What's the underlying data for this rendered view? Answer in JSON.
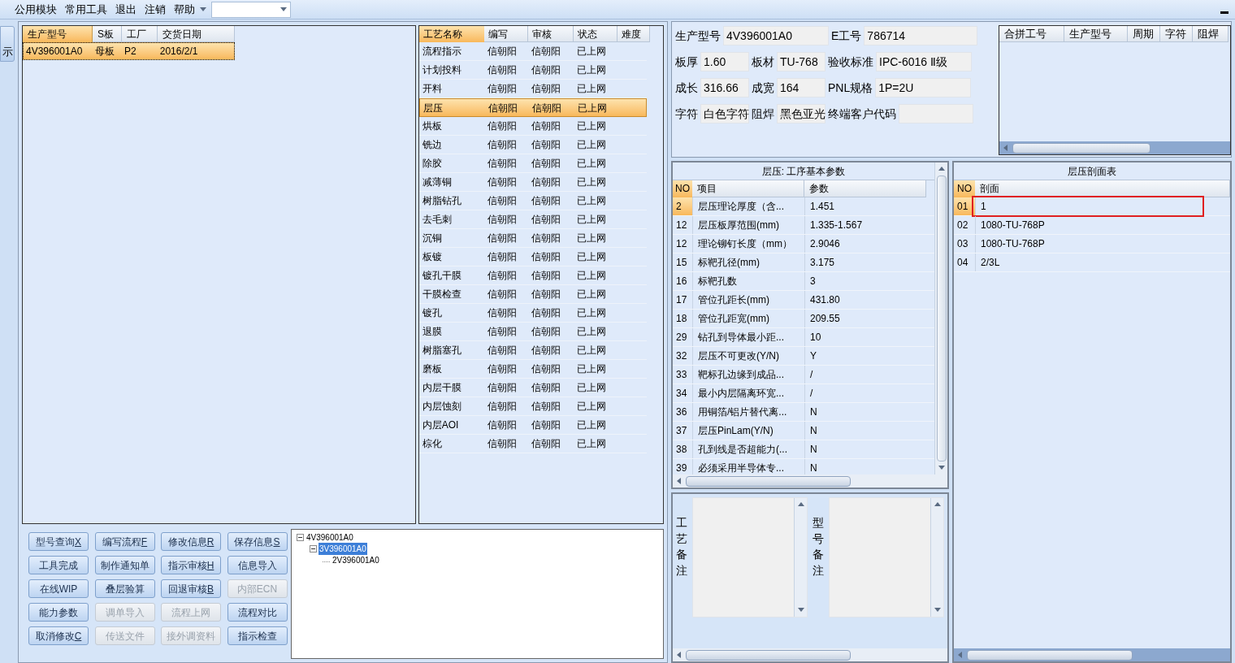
{
  "menu": {
    "items": [
      "公用模块",
      "常用工具",
      "退出",
      "注销",
      "帮助"
    ]
  },
  "side_button": "示",
  "order_table": {
    "columns": [
      "生产型号",
      "S板",
      "工厂",
      "交货日期"
    ],
    "rows": [
      {
        "cells": [
          "4V396001A0",
          "母板",
          "P2",
          "2016/2/1"
        ],
        "selected": true
      }
    ]
  },
  "process_table": {
    "columns": [
      "工艺名称",
      "编写",
      "审核",
      "状态",
      "难度"
    ],
    "rows": [
      {
        "cells": [
          "流程指示",
          "信朝阳",
          "信朝阳",
          "已上网"
        ],
        "selected": false
      },
      {
        "cells": [
          "计划投料",
          "信朝阳",
          "信朝阳",
          "已上网"
        ],
        "selected": false
      },
      {
        "cells": [
          "开料",
          "信朝阳",
          "信朝阳",
          "已上网"
        ],
        "selected": false
      },
      {
        "cells": [
          "层压",
          "信朝阳",
          "信朝阳",
          "已上网"
        ],
        "selected": true
      },
      {
        "cells": [
          "烘板",
          "信朝阳",
          "信朝阳",
          "已上网"
        ],
        "selected": false
      },
      {
        "cells": [
          "铣边",
          "信朝阳",
          "信朝阳",
          "已上网"
        ],
        "selected": false
      },
      {
        "cells": [
          "除胶",
          "信朝阳",
          "信朝阳",
          "已上网"
        ],
        "selected": false
      },
      {
        "cells": [
          "减薄铜",
          "信朝阳",
          "信朝阳",
          "已上网"
        ],
        "selected": false
      },
      {
        "cells": [
          "树脂钻孔",
          "信朝阳",
          "信朝阳",
          "已上网"
        ],
        "selected": false
      },
      {
        "cells": [
          "去毛刺",
          "信朝阳",
          "信朝阳",
          "已上网"
        ],
        "selected": false
      },
      {
        "cells": [
          "沉铜",
          "信朝阳",
          "信朝阳",
          "已上网"
        ],
        "selected": false
      },
      {
        "cells": [
          "板镀",
          "信朝阳",
          "信朝阳",
          "已上网"
        ],
        "selected": false
      },
      {
        "cells": [
          "镀孔干膜",
          "信朝阳",
          "信朝阳",
          "已上网"
        ],
        "selected": false
      },
      {
        "cells": [
          "干膜检查",
          "信朝阳",
          "信朝阳",
          "已上网"
        ],
        "selected": false
      },
      {
        "cells": [
          "镀孔",
          "信朝阳",
          "信朝阳",
          "已上网"
        ],
        "selected": false
      },
      {
        "cells": [
          "退膜",
          "信朝阳",
          "信朝阳",
          "已上网"
        ],
        "selected": false
      },
      {
        "cells": [
          "树脂塞孔",
          "信朝阳",
          "信朝阳",
          "已上网"
        ],
        "selected": false
      },
      {
        "cells": [
          "磨板",
          "信朝阳",
          "信朝阳",
          "已上网"
        ],
        "selected": false
      },
      {
        "cells": [
          "内层干膜",
          "信朝阳",
          "信朝阳",
          "已上网"
        ],
        "selected": false
      },
      {
        "cells": [
          "内层蚀刻",
          "信朝阳",
          "信朝阳",
          "已上网"
        ],
        "selected": false
      },
      {
        "cells": [
          "内层AOI",
          "信朝阳",
          "信朝阳",
          "已上网"
        ],
        "selected": false
      },
      {
        "cells": [
          "棕化",
          "信朝阳",
          "信朝阳",
          "已上网"
        ],
        "selected": false
      }
    ]
  },
  "buttons": [
    {
      "label": "型号查询",
      "key": "X",
      "disabled": false
    },
    {
      "label": "编写流程",
      "key": "F",
      "disabled": false
    },
    {
      "label": "修改信息",
      "key": "R",
      "disabled": false
    },
    {
      "label": "保存信息",
      "key": "S",
      "disabled": false
    },
    {
      "label": "工具完成",
      "disabled": false
    },
    {
      "label": "制作通知单",
      "disabled": false
    },
    {
      "label": "指示审核",
      "key": "H",
      "disabled": false
    },
    {
      "label": "信息导入",
      "disabled": false
    },
    {
      "label": "在线WIP",
      "disabled": false
    },
    {
      "label": "叠层验算",
      "disabled": false
    },
    {
      "label": "回退审核",
      "key": "B",
      "disabled": false
    },
    {
      "label": "内部ECN",
      "disabled": true
    },
    {
      "label": "能力参数",
      "disabled": false
    },
    {
      "label": "调单导入",
      "disabled": true
    },
    {
      "label": "流程上网",
      "disabled": true
    },
    {
      "label": "流程对比",
      "disabled": false
    },
    {
      "label": "取消修改",
      "key": "C",
      "disabled": false
    },
    {
      "label": "传送文件",
      "disabled": true
    },
    {
      "label": "接外调资料",
      "disabled": true
    },
    {
      "label": "指示检查",
      "disabled": false
    }
  ],
  "tree": {
    "items": [
      {
        "label": "4V396001A0",
        "expanded": true,
        "selected": false,
        "children": [
          {
            "label": "3V396001A0",
            "expanded": true,
            "selected": true,
            "children": [
              {
                "label": "2V396001A0",
                "selected": false
              }
            ]
          }
        ]
      }
    ]
  },
  "info_form": {
    "fields": [
      {
        "label": "生产型号",
        "value": "4V396001A0"
      },
      {
        "label": "E工号",
        "value": "786714"
      },
      {
        "label": "板厚",
        "value": "1.60"
      },
      {
        "label": "板材",
        "value": "TU-768"
      },
      {
        "label": "验收标准",
        "value": "IPC-6016 Ⅱ级"
      },
      {
        "label": "成长",
        "value": "316.66"
      },
      {
        "label": "成宽",
        "value": "164"
      },
      {
        "label": "PNL规格",
        "value": "1P=2U"
      },
      {
        "label": "字符",
        "value": "白色字符"
      },
      {
        "label": "阻焊",
        "value": "黑色亚光"
      },
      {
        "label": "终端客户代码"
      }
    ]
  },
  "merged_table": {
    "columns": [
      "合拼工号",
      "生产型号",
      "周期",
      "字符",
      "阻焊"
    ]
  },
  "params_table": {
    "title": "层压: 工序基本参数",
    "columns": [
      "NO",
      "项目",
      "参数"
    ],
    "rows": [
      {
        "cells": [
          "2",
          "层压理论厚度（含...",
          "1.451"
        ],
        "selected": true
      },
      {
        "cells": [
          "12",
          "层压板厚范围(mm)",
          "1.335-1.567"
        ],
        "selected": false
      },
      {
        "cells": [
          "12",
          "理论铆钉长度（mm）",
          "2.9046"
        ],
        "selected": false
      },
      {
        "cells": [
          "15",
          "标靶孔径(mm)",
          "3.175"
        ],
        "selected": false
      },
      {
        "cells": [
          "16",
          "标靶孔数",
          "3"
        ],
        "selected": false
      },
      {
        "cells": [
          "17",
          "管位孔距长(mm)",
          "431.80"
        ],
        "selected": false
      },
      {
        "cells": [
          "18",
          "管位孔距宽(mm)",
          "209.55"
        ],
        "selected": false
      },
      {
        "cells": [
          "29",
          "钻孔到导体最小距...",
          "10"
        ],
        "selected": false
      },
      {
        "cells": [
          "32",
          "层压不可更改(Y/N)",
          "Y"
        ],
        "selected": false
      },
      {
        "cells": [
          "33",
          "靶标孔边缘到成品...",
          "/"
        ],
        "selected": false
      },
      {
        "cells": [
          "34",
          "最小内层隔离环宽...",
          "/"
        ],
        "selected": false
      },
      {
        "cells": [
          "36",
          "用铜箔/铝片替代离...",
          "N"
        ],
        "selected": false
      },
      {
        "cells": [
          "37",
          "层压PinLam(Y/N)",
          "N"
        ],
        "selected": false
      },
      {
        "cells": [
          "38",
          "孔到线是否超能力(...",
          "N"
        ],
        "selected": false
      },
      {
        "cells": [
          "39",
          "必须采用半导体专...",
          "N"
        ],
        "selected": false
      }
    ]
  },
  "remarks": [
    {
      "label": "工艺备注"
    },
    {
      "label": "型号备注"
    }
  ],
  "section_table": {
    "title": "层压剖面表",
    "columns": [
      "NO",
      "剖面"
    ],
    "rows": [
      {
        "cells": [
          "01",
          "1"
        ],
        "selected": true,
        "highlighted": true
      },
      {
        "cells": [
          "02",
          "1080-TU-768P"
        ],
        "selected": false,
        "highlighted": false
      },
      {
        "cells": [
          "03",
          "1080-TU-768P"
        ],
        "selected": false,
        "highlighted": false
      },
      {
        "cells": [
          "04",
          "2/3L"
        ],
        "selected": false,
        "highlighted": false
      }
    ]
  }
}
